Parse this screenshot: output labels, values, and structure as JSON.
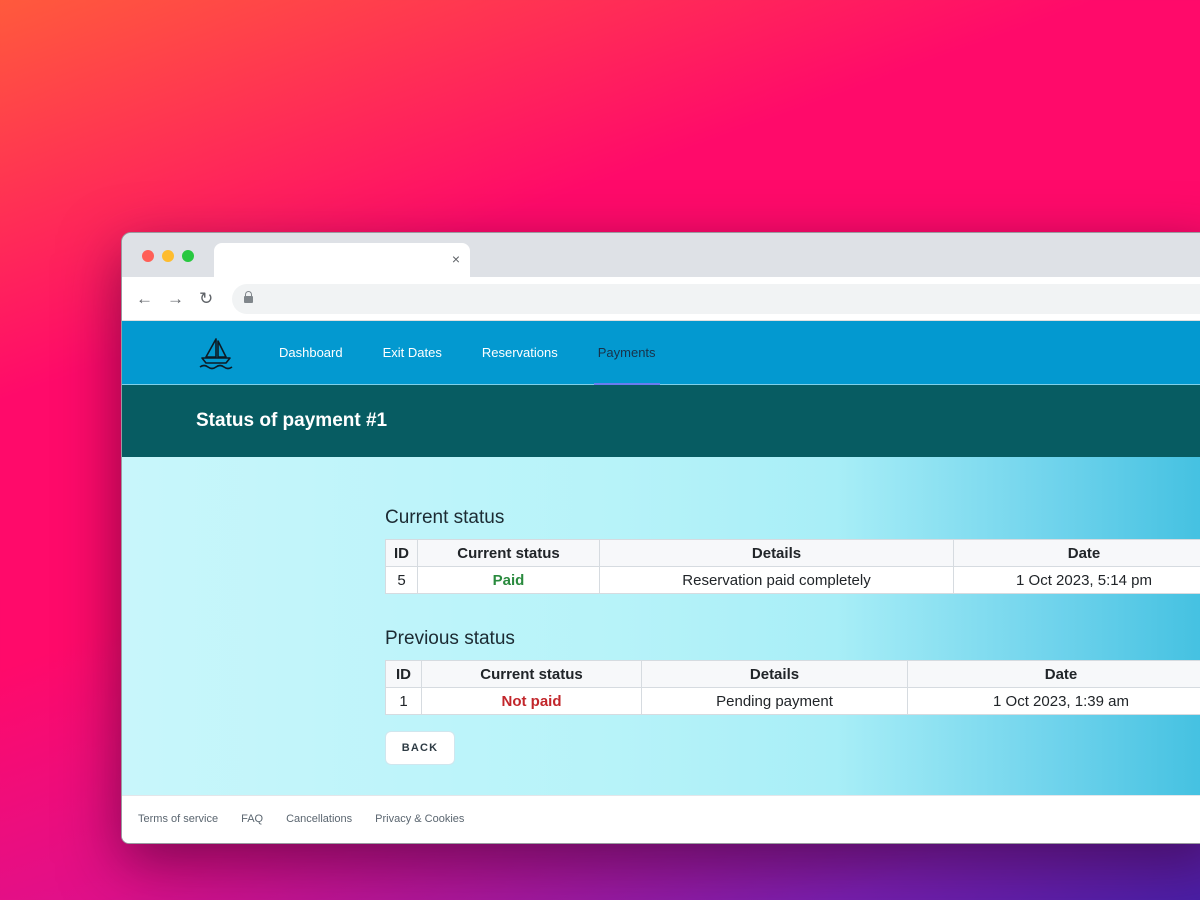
{
  "browser": {
    "tab_close": "×",
    "nav": {
      "back": "←",
      "forward": "→",
      "reload": "↻"
    }
  },
  "site_nav": {
    "logo_icon": "sailboat-icon",
    "links": [
      "Dashboard",
      "Exit Dates",
      "Reservations",
      "Payments"
    ],
    "active": "Payments",
    "colors": {
      "nav_bg": "#0399d0",
      "header_bg": "#075c62"
    }
  },
  "page": {
    "title": "Status of payment #1"
  },
  "current_status": {
    "heading": "Current status",
    "columns": [
      "ID",
      "Current status",
      "Details",
      "Date"
    ],
    "rows": [
      {
        "id": "5",
        "status": "Paid",
        "details": "Reservation paid completely",
        "date": "1 Oct 2023, 5:14 pm"
      }
    ]
  },
  "previous_status": {
    "heading": "Previous status",
    "columns": [
      "ID",
      "Current status",
      "Details",
      "Date"
    ],
    "rows": [
      {
        "id": "1",
        "status": "Not paid",
        "details": "Pending payment",
        "date": "1 Oct 2023, 1:39 am"
      }
    ]
  },
  "back_button": "BACK",
  "footer": {
    "links": [
      "Terms of service",
      "FAQ",
      "Cancellations",
      "Privacy & Cookies"
    ]
  }
}
